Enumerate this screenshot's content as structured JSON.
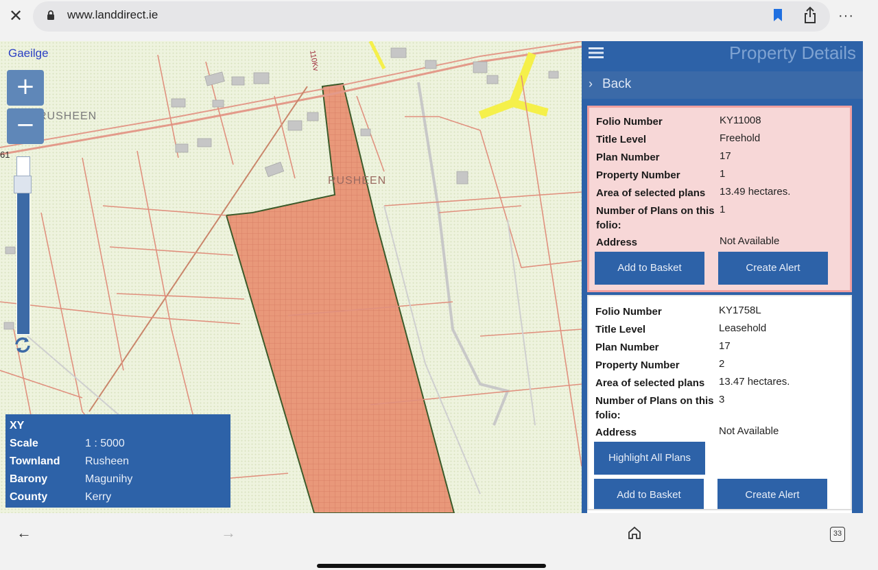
{
  "browser": {
    "url": "www.landdirect.ie",
    "close_icon": "close-icon",
    "more_label": "···",
    "tab_count": "33"
  },
  "map": {
    "language_link": "Gaeilge",
    "zoom_in_label": "+",
    "zoom_out_label": "−",
    "townland_labels": [
      "RUSHEEN",
      "RUSHEEN"
    ],
    "power_line_label": "110Kv",
    "edge_number": "61",
    "info": {
      "xy_label": "XY",
      "rows": [
        {
          "key": "Scale",
          "value": "1 : 5000"
        },
        {
          "key": "Townland",
          "value": "Rusheen"
        },
        {
          "key": "Barony",
          "value": "Magunihy"
        },
        {
          "key": "County",
          "value": "Kerry"
        }
      ]
    }
  },
  "panel": {
    "title": "Property Details",
    "back_label": "Back",
    "back_chevron": "›",
    "results": [
      {
        "folio_number_label": "Folio Number",
        "folio_number": "KY11008",
        "title_level_label": "Title Level",
        "title_level": "Freehold",
        "plan_number_label": "Plan Number",
        "plan_number": "17",
        "property_number_label": "Property Number",
        "property_number": "1",
        "area_label": "Area of selected plans",
        "area": "13.49 hectares.",
        "plans_count_label": "Number of Plans on this folio:",
        "plans_count": "1",
        "address_label": "Address",
        "address": "Not Available",
        "add_to_basket": "Add to Basket",
        "create_alert": "Create Alert"
      },
      {
        "folio_number_label": "Folio Number",
        "folio_number": "KY1758L",
        "title_level_label": "Title Level",
        "title_level": "Leasehold",
        "plan_number_label": "Plan Number",
        "plan_number": "17",
        "property_number_label": "Property Number",
        "property_number": "2",
        "area_label": "Area of selected plans",
        "area": "13.47 hectares.",
        "plans_count_label": "Number of Plans on this folio:",
        "plans_count": "3",
        "address_label": "Address",
        "address": "Not Available",
        "highlight_all_plans": "Highlight All Plans",
        "add_to_basket": "Add to Basket",
        "create_alert": "Create Alert"
      }
    ]
  },
  "colors": {
    "panel_blue": "#2d62a8",
    "selected_card": "#f7d7d7",
    "parcel_fill": "#e9987a",
    "road_highlight": "#f5f04a"
  }
}
